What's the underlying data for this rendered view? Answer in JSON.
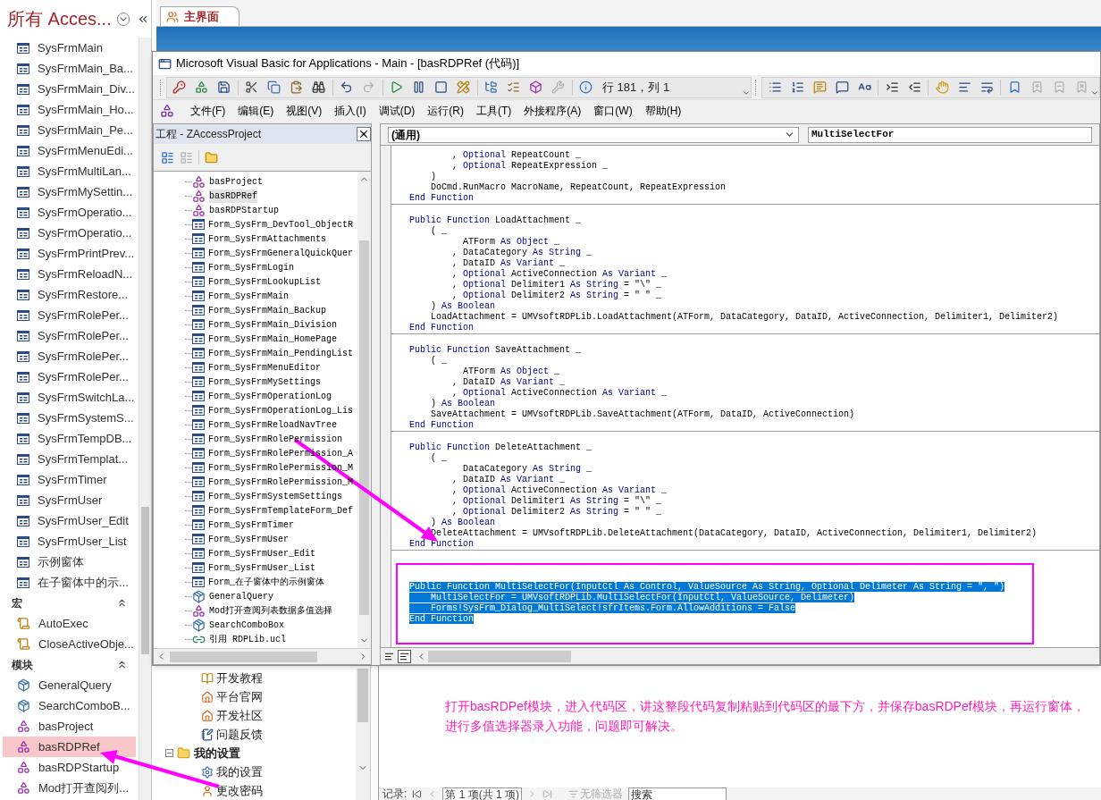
{
  "nav": {
    "title": "所有 Acces...",
    "sections": [
      {
        "items": [
          {
            "label": "SysFrmMain",
            "kind": "form",
            "selected": false
          },
          {
            "label": "SysFrmMain_Ba...",
            "kind": "form",
            "selected": false
          },
          {
            "label": "SysFrmMain_Div...",
            "kind": "form",
            "selected": false
          },
          {
            "label": "SysFrmMain_Ho...",
            "kind": "form",
            "selected": false
          },
          {
            "label": "SysFrmMain_Pe...",
            "kind": "form",
            "selected": false
          },
          {
            "label": "SysFrmMenuEdi...",
            "kind": "form",
            "selected": false
          },
          {
            "label": "SysFrmMultiLan...",
            "kind": "form",
            "selected": false
          },
          {
            "label": "SysFrmMySettin...",
            "kind": "form",
            "selected": false
          },
          {
            "label": "SysFrmOperatio...",
            "kind": "form",
            "selected": false
          },
          {
            "label": "SysFrmOperatio...",
            "kind": "form",
            "selected": false
          },
          {
            "label": "SysFrmPrintPrev...",
            "kind": "form",
            "selected": false
          },
          {
            "label": "SysFrmReloadN...",
            "kind": "form",
            "selected": false
          },
          {
            "label": "SysFrmRestore...",
            "kind": "form",
            "selected": false
          },
          {
            "label": "SysFrmRolePer...",
            "kind": "form",
            "selected": false
          },
          {
            "label": "SysFrmRolePer...",
            "kind": "form",
            "selected": false
          },
          {
            "label": "SysFrmRolePer...",
            "kind": "form",
            "selected": false
          },
          {
            "label": "SysFrmRolePer...",
            "kind": "form",
            "selected": false
          },
          {
            "label": "SysFrmSwitchLa...",
            "kind": "form",
            "selected": false
          },
          {
            "label": "SysFrmSystemS...",
            "kind": "form",
            "selected": false
          },
          {
            "label": "SysFrmTempDB...",
            "kind": "form",
            "selected": false
          },
          {
            "label": "SysFrmTemplat...",
            "kind": "form",
            "selected": false
          },
          {
            "label": "SysFrmTimer",
            "kind": "form",
            "selected": false
          },
          {
            "label": "SysFrmUser",
            "kind": "form",
            "selected": false
          },
          {
            "label": "SysFrmUser_Edit",
            "kind": "form",
            "selected": false
          },
          {
            "label": "SysFrmUser_List",
            "kind": "form",
            "selected": false
          },
          {
            "label": "示例窗体",
            "kind": "form",
            "selected": false
          },
          {
            "label": "在子窗体中的示...",
            "kind": "form",
            "selected": false
          }
        ]
      },
      {
        "header": "宏",
        "expanded": true,
        "items": [
          {
            "label": "AutoExec",
            "kind": "macro",
            "selected": false
          },
          {
            "label": "CloseActiveObje...",
            "kind": "macro",
            "selected": false
          }
        ]
      },
      {
        "header": "模块",
        "expanded": true,
        "items": [
          {
            "label": "GeneralQuery",
            "kind": "class_module",
            "selected": false
          },
          {
            "label": "SearchComboB...",
            "kind": "class_module",
            "selected": false
          },
          {
            "label": "basProject",
            "kind": "module",
            "selected": false
          },
          {
            "label": "basRDPRef",
            "kind": "module",
            "selected": true
          },
          {
            "label": "basRDPStartup",
            "kind": "module",
            "selected": false
          },
          {
            "label": "Mod打开查阅列...",
            "kind": "module",
            "selected": false
          }
        ]
      }
    ]
  },
  "tabs": [
    {
      "label": "主界面",
      "selected": true
    }
  ],
  "access_tree": [
    {
      "label": "开发教程",
      "kind": "help"
    },
    {
      "label": "平台官网",
      "kind": "web"
    },
    {
      "label": "开发社区",
      "kind": "web"
    },
    {
      "label": "问题反馈",
      "kind": "feedback"
    },
    {
      "label": "我的设置",
      "kind": "folder",
      "expanded": true,
      "children": [
        {
          "label": "我的设置",
          "kind": "settings"
        },
        {
          "label": "更改密码",
          "kind": "user"
        }
      ]
    }
  ],
  "annotation": {
    "text": "打开basRDPef模块，进入代码区，讲这整段代码复制粘贴到代码区的最下方，并保存basRDPef模块，再运行窗体，进行多值选择器录入功能，问题即可解决。"
  },
  "record_bar": {
    "label": "记录:",
    "position": "第 1 项(共 1 项)",
    "filter": "无筛选器",
    "filter_active": false,
    "search_placeholder": "搜索"
  },
  "vba": {
    "title": "Microsoft Visual Basic for Applications - Main - [basRDPRef (代码)]",
    "toolbar": [
      {
        "disabled": false
      },
      {
        "disabled": false
      },
      {
        "disabled": false
      },
      {
        "disabled": false
      },
      {
        "disabled": false
      },
      {
        "disabled": false
      },
      {
        "disabled": false
      },
      {
        "disabled": false
      },
      {
        "disabled": true
      },
      {
        "disabled": false
      },
      {
        "disabled": false
      },
      {
        "disabled": false
      },
      {
        "disabled": false
      },
      {
        "disabled": false
      },
      {
        "disabled": false
      },
      {
        "disabled": false
      },
      {
        "disabled": true
      },
      {
        "disabled": false
      }
    ],
    "cursor_position": "行 181，列 1",
    "edit_toolbar": [
      {
        "disabled": false
      },
      {
        "disabled": false
      },
      {
        "disabled": false
      },
      {
        "disabled": false
      },
      {
        "disabled": false
      },
      {
        "disabled": false
      },
      {
        "disabled": false
      },
      {
        "disabled": false
      },
      {
        "disabled": false
      },
      {
        "disabled": false
      },
      {
        "disabled": false
      },
      {
        "disabled": true
      },
      {
        "disabled": true
      },
      {
        "disabled": true
      }
    ],
    "menu": [
      "文件(F)",
      "编辑(E)",
      "视图(V)",
      "插入(I)",
      "调试(D)",
      "运行(R)",
      "工具(T)",
      "外接程序(A)",
      "窗口(W)",
      "帮助(H)"
    ],
    "project": {
      "title": "工程 - ZAccessProject",
      "items": [
        {
          "label": "basProject",
          "kind": "module",
          "selected": false
        },
        {
          "label": "basRDPRef",
          "kind": "module",
          "selected": true
        },
        {
          "label": "basRDPStartup",
          "kind": "module",
          "selected": false
        },
        {
          "label": "Form_SysFrm_DevTool_ObjectR",
          "kind": "form",
          "selected": false
        },
        {
          "label": "Form_SysFrmAttachments",
          "kind": "form",
          "selected": false
        },
        {
          "label": "Form_SysFrmGeneralQuickQuer",
          "kind": "form",
          "selected": false
        },
        {
          "label": "Form_SysFrmLogin",
          "kind": "form",
          "selected": false
        },
        {
          "label": "Form_SysFrmLookupList",
          "kind": "form",
          "selected": false
        },
        {
          "label": "Form_SysFrmMain",
          "kind": "form",
          "selected": false
        },
        {
          "label": "Form_SysFrmMain_Backup",
          "kind": "form",
          "selected": false
        },
        {
          "label": "Form_SysFrmMain_Division",
          "kind": "form",
          "selected": false
        },
        {
          "label": "Form_SysFrmMain_HomePage",
          "kind": "form",
          "selected": false
        },
        {
          "label": "Form_SysFrmMain_PendingList",
          "kind": "form",
          "selected": false
        },
        {
          "label": "Form_SysFrmMenuEditor",
          "kind": "form",
          "selected": false
        },
        {
          "label": "Form_SysFrmMySettings",
          "kind": "form",
          "selected": false
        },
        {
          "label": "Form_SysFrmOperationLog",
          "kind": "form",
          "selected": false
        },
        {
          "label": "Form_SysFrmOperationLog_Lis",
          "kind": "form",
          "selected": false
        },
        {
          "label": "Form_SysFrmReloadNavTree",
          "kind": "form",
          "selected": false
        },
        {
          "label": "Form_SysFrmRolePermission",
          "kind": "form",
          "selected": false
        },
        {
          "label": "Form_SysFrmRolePermission_A",
          "kind": "form",
          "selected": false
        },
        {
          "label": "Form_SysFrmRolePermission_M",
          "kind": "form",
          "selected": false
        },
        {
          "label": "Form_SysFrmRolePermission_M",
          "kind": "form",
          "selected": false
        },
        {
          "label": "Form_SysFrmSystemSettings",
          "kind": "form",
          "selected": false
        },
        {
          "label": "Form_SysFrmTemplateForm_Def",
          "kind": "form",
          "selected": false
        },
        {
          "label": "Form_SysFrmTimer",
          "kind": "form",
          "selected": false
        },
        {
          "label": "Form_SysFrmUser",
          "kind": "form",
          "selected": false
        },
        {
          "label": "Form_SysFrmUser_Edit",
          "kind": "form",
          "selected": false
        },
        {
          "label": "Form_SysFrmUser_List",
          "kind": "form",
          "selected": false
        },
        {
          "label": "Form_在子窗体中的示例窗体",
          "kind": "form",
          "selected": false
        },
        {
          "label": "GeneralQuery",
          "kind": "class_module",
          "selected": false
        },
        {
          "label": "Mod打开查阅列表数据多值选择",
          "kind": "module",
          "selected": false
        },
        {
          "label": "SearchComboBox",
          "kind": "class_module",
          "selected": false
        },
        {
          "label": "引用 RDPLib.ucl",
          "kind": "reference",
          "selected": false
        }
      ]
    },
    "object_box": "(通用)",
    "procedure_box": "MultiSelectFor",
    "procedures": [
      {
        "selected": false,
        "lines": [
          [
            {
              "text": "        , ",
              "keyword": false
            },
            {
              "text": "Optional",
              "keyword": true
            },
            {
              "text": " RepeatCount _",
              "keyword": false
            }
          ],
          [
            {
              "text": "        , ",
              "keyword": false
            },
            {
              "text": "Optional",
              "keyword": true
            },
            {
              "text": " RepeatExpression _",
              "keyword": false
            }
          ],
          [
            {
              "text": "    )",
              "keyword": false
            }
          ],
          [
            {
              "text": "    DoCmd.RunMacro MacroName, RepeatCount, RepeatExpression",
              "keyword": false
            }
          ],
          [
            {
              "text": "End Function",
              "keyword": true
            }
          ]
        ]
      },
      {
        "selected": false,
        "lines": [
          [
            {
              "text": "Public Function",
              "keyword": true
            },
            {
              "text": " LoadAttachment _",
              "keyword": false
            }
          ],
          [
            {
              "text": "    ( _",
              "keyword": false
            }
          ],
          [
            {
              "text": "          ATForm ",
              "keyword": false
            },
            {
              "text": "As Object",
              "keyword": true
            },
            {
              "text": " _",
              "keyword": false
            }
          ],
          [
            {
              "text": "        , DataCategory ",
              "keyword": false
            },
            {
              "text": "As String",
              "keyword": true
            },
            {
              "text": " _",
              "keyword": false
            }
          ],
          [
            {
              "text": "        , DataID ",
              "keyword": false
            },
            {
              "text": "As Variant",
              "keyword": true
            },
            {
              "text": " _",
              "keyword": false
            }
          ],
          [
            {
              "text": "        , ",
              "keyword": false
            },
            {
              "text": "Optional",
              "keyword": true
            },
            {
              "text": " ActiveConnection ",
              "keyword": false
            },
            {
              "text": "As Variant",
              "keyword": true
            },
            {
              "text": " _",
              "keyword": false
            }
          ],
          [
            {
              "text": "        , ",
              "keyword": false
            },
            {
              "text": "Optional",
              "keyword": true
            },
            {
              "text": " Delimiter1 ",
              "keyword": false
            },
            {
              "text": "As String",
              "keyword": true
            },
            {
              "text": " = \"\\\" _",
              "keyword": false
            }
          ],
          [
            {
              "text": "        , ",
              "keyword": false
            },
            {
              "text": "Optional",
              "keyword": true
            },
            {
              "text": " Delimiter2 ",
              "keyword": false
            },
            {
              "text": "As String",
              "keyword": true
            },
            {
              "text": " = \" \" _",
              "keyword": false
            }
          ],
          [
            {
              "text": "    ) ",
              "keyword": false
            },
            {
              "text": "As Boolean",
              "keyword": true
            }
          ],
          [
            {
              "text": "    LoadAttachment = UMVsoftRDPLib.LoadAttachment(ATForm, DataCategory, DataID, ActiveConnection, Delimiter1, Delimiter2)",
              "keyword": false
            }
          ],
          [
            {
              "text": "End Function",
              "keyword": true
            }
          ]
        ]
      },
      {
        "selected": false,
        "lines": [
          [
            {
              "text": "Public Function",
              "keyword": true
            },
            {
              "text": " SaveAttachment _",
              "keyword": false
            }
          ],
          [
            {
              "text": "    ( _",
              "keyword": false
            }
          ],
          [
            {
              "text": "          ATForm ",
              "keyword": false
            },
            {
              "text": "As Object",
              "keyword": true
            },
            {
              "text": " _",
              "keyword": false
            }
          ],
          [
            {
              "text": "        , DataID ",
              "keyword": false
            },
            {
              "text": "As Variant",
              "keyword": true
            },
            {
              "text": " _",
              "keyword": false
            }
          ],
          [
            {
              "text": "        , ",
              "keyword": false
            },
            {
              "text": "Optional",
              "keyword": true
            },
            {
              "text": " ActiveConnection ",
              "keyword": false
            },
            {
              "text": "As Variant",
              "keyword": true
            },
            {
              "text": " _",
              "keyword": false
            }
          ],
          [
            {
              "text": "    ) ",
              "keyword": false
            },
            {
              "text": "As Boolean",
              "keyword": true
            }
          ],
          [
            {
              "text": "    SaveAttachment = UMVsoftRDPLib.SaveAttachment(ATForm, DataID, ActiveConnection)",
              "keyword": false
            }
          ],
          [
            {
              "text": "End Function",
              "keyword": true
            }
          ]
        ]
      },
      {
        "selected": false,
        "lines": [
          [
            {
              "text": "Public Function",
              "keyword": true
            },
            {
              "text": " DeleteAttachment _",
              "keyword": false
            }
          ],
          [
            {
              "text": "    ( _",
              "keyword": false
            }
          ],
          [
            {
              "text": "          DataCategory ",
              "keyword": false
            },
            {
              "text": "As String",
              "keyword": true
            },
            {
              "text": " _",
              "keyword": false
            }
          ],
          [
            {
              "text": "        , DataID ",
              "keyword": false
            },
            {
              "text": "As Variant",
              "keyword": true
            },
            {
              "text": " _",
              "keyword": false
            }
          ],
          [
            {
              "text": "        , ",
              "keyword": false
            },
            {
              "text": "Optional",
              "keyword": true
            },
            {
              "text": " ActiveConnection ",
              "keyword": false
            },
            {
              "text": "As Variant",
              "keyword": true
            },
            {
              "text": " _",
              "keyword": false
            }
          ],
          [
            {
              "text": "        , ",
              "keyword": false
            },
            {
              "text": "Optional",
              "keyword": true
            },
            {
              "text": " Delimiter1 ",
              "keyword": false
            },
            {
              "text": "As String",
              "keyword": true
            },
            {
              "text": " = \"\\\" _",
              "keyword": false
            }
          ],
          [
            {
              "text": "        , ",
              "keyword": false
            },
            {
              "text": "Optional",
              "keyword": true
            },
            {
              "text": " Delimiter2 ",
              "keyword": false
            },
            {
              "text": "As String",
              "keyword": true
            },
            {
              "text": " = \" \" _",
              "keyword": false
            }
          ],
          [
            {
              "text": "    ) ",
              "keyword": false
            },
            {
              "text": "As Boolean",
              "keyword": true
            }
          ],
          [
            {
              "text": "    DeleteAttachment = UMVsoftRDPLib.DeleteAttachment(DataCategory, DataID, ActiveConnection, Delimiter1, Delimiter2)",
              "keyword": false
            }
          ],
          [
            {
              "text": "End Function",
              "keyword": true
            }
          ]
        ]
      },
      {
        "selected": true,
        "lines": [
          [
            {
              "text": "Public Function MultiSelectFor(InputCtl As Control, ValueSource As String, Optional Delimeter As String = \", \")"
            }
          ],
          [
            {
              "text": "    MultiSelectFor = UMVsoftRDPLib.MultiSelectFor(InputCtl, ValueSource, Delimeter)"
            }
          ],
          [
            {
              "text": "    Forms!SysFrm_Dialog_MultiSelect!sfrItems.Form.AllowAdditions = False"
            }
          ],
          [
            {
              "text": "End Function"
            }
          ]
        ]
      }
    ],
    "view_buttons": [
      {
        "selected": false
      },
      {
        "selected": true
      }
    ]
  }
}
